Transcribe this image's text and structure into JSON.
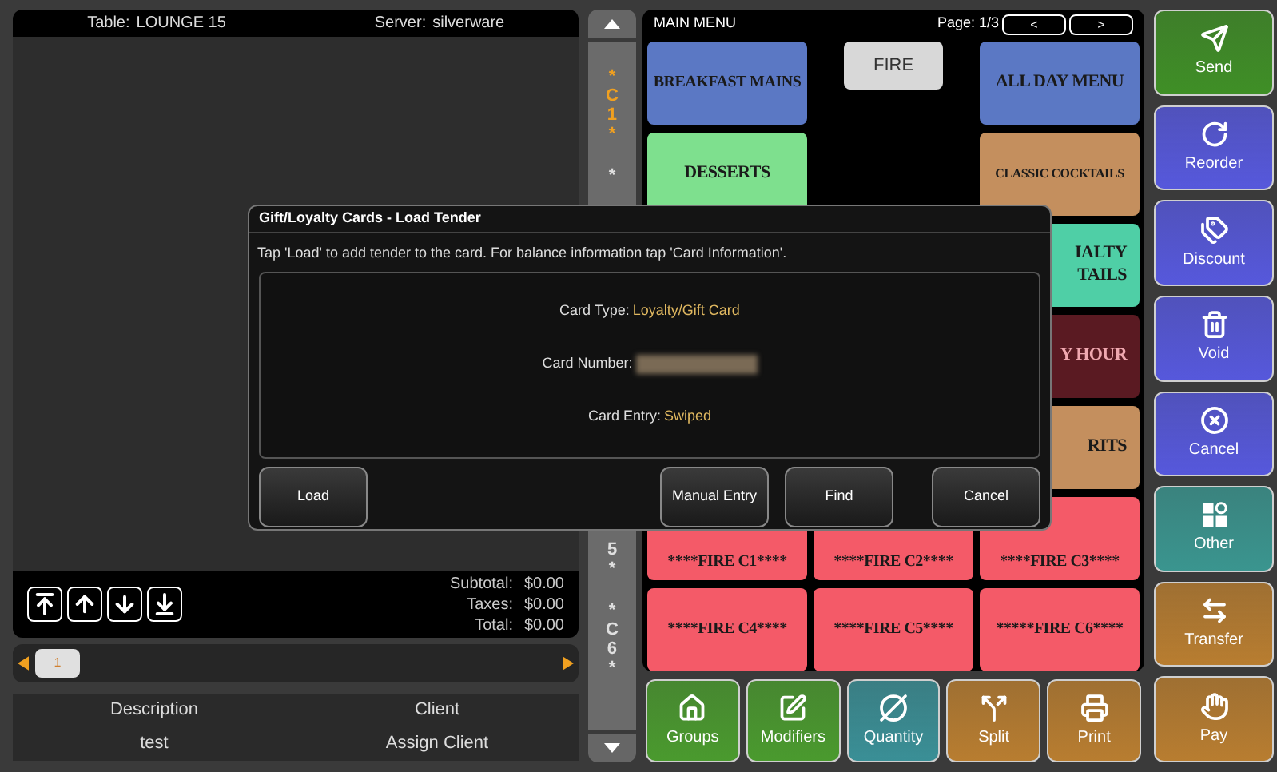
{
  "order_panel": {
    "table_label": "Table:",
    "table": "LOUNGE 15",
    "server_label": "Server:",
    "server": "silverware"
  },
  "scroll_buttons": [
    {
      "kind": "top"
    },
    {
      "kind": "up"
    },
    {
      "kind": "down"
    },
    {
      "kind": "bottom"
    }
  ],
  "totals": [
    {
      "label": "Subtotal:",
      "value": "$0.00"
    },
    {
      "label": "Taxes:",
      "value": "$0.00"
    },
    {
      "label": "Total:",
      "value": "$0.00"
    }
  ],
  "check_tabs": [
    {
      "label": "1",
      "selected": true
    }
  ],
  "info_table": {
    "columns": [
      "Description",
      "Client"
    ],
    "row": [
      "test",
      "Assign Client"
    ]
  },
  "seat_strip": [
    {
      "lines": [
        "*",
        "C",
        "1",
        "*"
      ],
      "selected": true
    },
    {
      "lines": [
        "*"
      ],
      "selected": false
    },
    {
      "lines": [
        "5",
        "*"
      ],
      "selected": false
    },
    {
      "lines": [
        "*",
        "C",
        "6",
        "*"
      ],
      "selected": false
    }
  ],
  "menu": {
    "title": "MAIN MENU",
    "page": "Page: 1/3",
    "prev": "<",
    "next": ">",
    "rows": [
      [
        {
          "kind": "tile",
          "label": "BREAKFAST MAINS",
          "color": "#5b78c4"
        },
        {
          "kind": "small",
          "label": "FIRE"
        },
        {
          "kind": "tile",
          "label": "ALL DAY MENU",
          "color": "#5b78c4"
        }
      ],
      [
        {
          "kind": "tile",
          "label": "DESSERTS",
          "color": "#7ee08e"
        },
        {
          "kind": "empty"
        },
        {
          "kind": "compact",
          "label": "CLASSIC COCKTAILS",
          "color": "#c48f5e"
        }
      ],
      [
        {
          "kind": "empty"
        },
        {
          "kind": "empty"
        },
        {
          "kind": "partial",
          "label": "IALTY TAILS",
          "color": "#4fcfa6"
        }
      ],
      [
        {
          "kind": "empty"
        },
        {
          "kind": "empty"
        },
        {
          "kind": "partial",
          "label": "Y HOUR",
          "color": "#5a1a22"
        }
      ],
      [
        {
          "kind": "empty"
        },
        {
          "kind": "empty"
        },
        {
          "kind": "partial",
          "label": "RITS",
          "color": "#c48f5e"
        }
      ],
      [
        {
          "kind": "lower",
          "label": "****FIRE C1****",
          "color": "#f45a68"
        },
        {
          "kind": "lower",
          "label": "****FIRE C2****",
          "color": "#f45a68"
        },
        {
          "kind": "lower",
          "label": "****FIRE C3****",
          "color": "#f45a68"
        }
      ],
      [
        {
          "kind": "tile",
          "label": "****FIRE C4****",
          "color": "#f45a68"
        },
        {
          "kind": "tile",
          "label": "****FIRE C5****",
          "color": "#f45a68"
        },
        {
          "kind": "tile",
          "label": "*****FIRE C6****",
          "color": "#f45a68"
        }
      ]
    ]
  },
  "bottom_buttons": [
    {
      "kind": "groups",
      "label": "Groups",
      "color": "#4a9a2e"
    },
    {
      "kind": "modifiers",
      "label": "Modifiers",
      "color": "#4a9a2e"
    },
    {
      "kind": "quantity",
      "label": "Quantity",
      "color": "#3a8f96"
    },
    {
      "kind": "split",
      "label": "Split",
      "color": "#b87d30"
    },
    {
      "kind": "print",
      "label": "Print",
      "color": "#b87d30"
    }
  ],
  "side_buttons": [
    {
      "kind": "send",
      "label": "Send",
      "color": "#3f8f26"
    },
    {
      "kind": "reorder",
      "label": "Reorder",
      "color": "#5658dc"
    },
    {
      "kind": "discount",
      "label": "Discount",
      "color": "#5658dc"
    },
    {
      "kind": "void",
      "label": "Void",
      "color": "#5658dc"
    },
    {
      "kind": "cancel",
      "label": "Cancel",
      "color": "#5658dc"
    },
    {
      "kind": "other",
      "label": "Other",
      "color": "#3a958f"
    },
    {
      "kind": "transfer",
      "label": "Transfer",
      "color": "#b87d30"
    },
    {
      "kind": "pay",
      "label": "Pay",
      "color": "#b87d30"
    }
  ],
  "dialog": {
    "title": "Gift/Loyalty Cards - Load Tender",
    "instruction": "Tap 'Load' to add tender to the card. For balance information tap 'Card Information'.",
    "fields": [
      {
        "kind": "text",
        "label": "Card Type:",
        "value": "Loyalty/Gift Card"
      },
      {
        "kind": "redacted",
        "label": "Card Number:"
      },
      {
        "kind": "text",
        "label": "Card Entry:",
        "value": "Swiped"
      }
    ],
    "buttons": [
      {
        "label": "Load",
        "kind": "left"
      },
      {
        "label": "Manual Entry",
        "kind": "middle"
      },
      {
        "label": "Find",
        "kind": "middle"
      },
      {
        "label": "Cancel",
        "kind": "right"
      }
    ]
  }
}
